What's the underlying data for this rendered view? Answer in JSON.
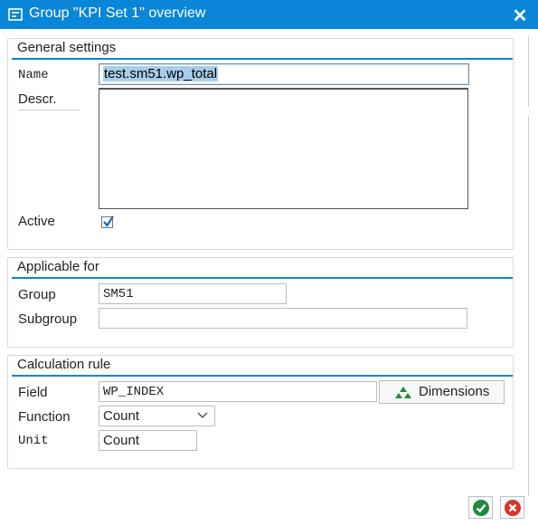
{
  "window": {
    "title": "Group \"KPI Set 1\" overview",
    "close_glyph": "✕",
    "accent_color": "#0a86d8"
  },
  "general": {
    "title": "General settings",
    "name_label": "Name",
    "name_value": "test.sm51.wp_total",
    "descr_label": "Descr.",
    "descr_value": "",
    "active_label": "Active",
    "active_checked": true
  },
  "applicable": {
    "title": "Applicable for",
    "group_label": "Group",
    "group_value": "SM51",
    "subgroup_label": "Subgroup",
    "subgroup_value": ""
  },
  "calculation": {
    "title": "Calculation rule",
    "field_label": "Field",
    "field_value": "WP_INDEX",
    "dimensions_button": "Dimensions",
    "function_label": "Function",
    "function_value": "Count",
    "unit_label": "Unit",
    "unit_value": "Count"
  },
  "footer": {
    "confirm_icon": "check-icon",
    "cancel_icon": "cancel-icon",
    "confirm_color": "#1e8a3c",
    "cancel_color": "#d9342b"
  }
}
